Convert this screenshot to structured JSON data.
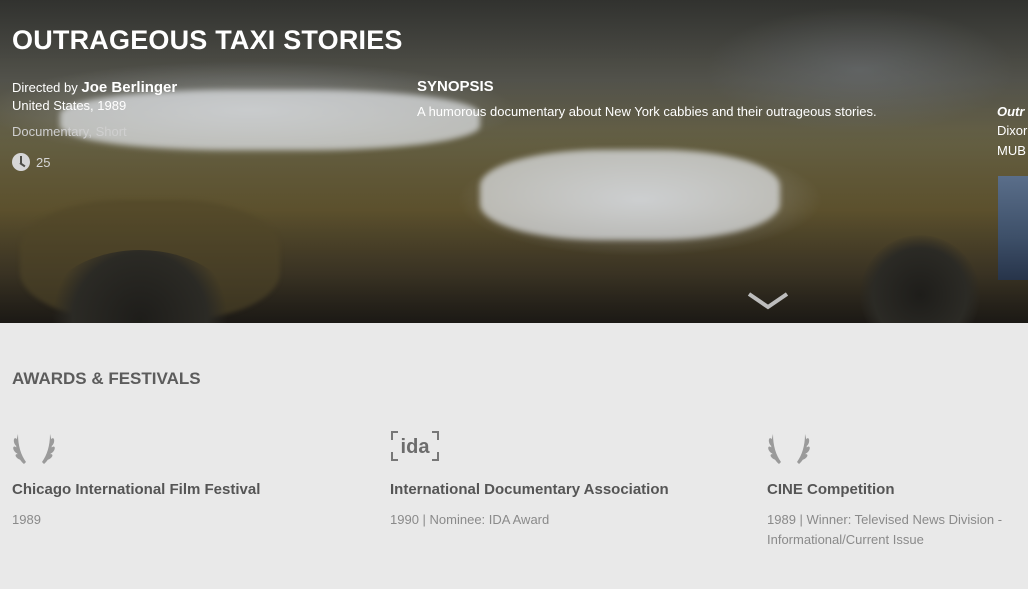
{
  "film": {
    "title": "OUTRAGEOUS TAXI STORIES",
    "directed_by_label": "Directed by",
    "director": "Joe Berlinger",
    "country_year": "United States, 1989",
    "genres": "Documentary, Short",
    "duration": "25"
  },
  "synopsis": {
    "heading": "SYNOPSIS",
    "text": "A humorous documentary about New York cabbies and their outrageous stories."
  },
  "side_panel": {
    "title_fragment": "Outr",
    "line1_fragment": "Dixor",
    "line2_fragment": "MUB"
  },
  "awards_section": {
    "heading": "AWARDS & FESTIVALS",
    "items": [
      {
        "logo": "laurel-icon",
        "name": "Chicago International Film Festival",
        "detail": "1989"
      },
      {
        "logo": "ida-logo",
        "logo_text": "ida",
        "name": "International Documentary Association",
        "detail": "1990 | Nominee: IDA Award"
      },
      {
        "logo": "laurel-icon",
        "name": "CINE Competition",
        "detail": "1989 | Winner: Televised News Division - Informational/Current Issue"
      }
    ]
  },
  "colors": {
    "section_background": "#e9e9e9",
    "heading_text": "#5c5c5c",
    "detail_text": "#8a8a8a"
  }
}
